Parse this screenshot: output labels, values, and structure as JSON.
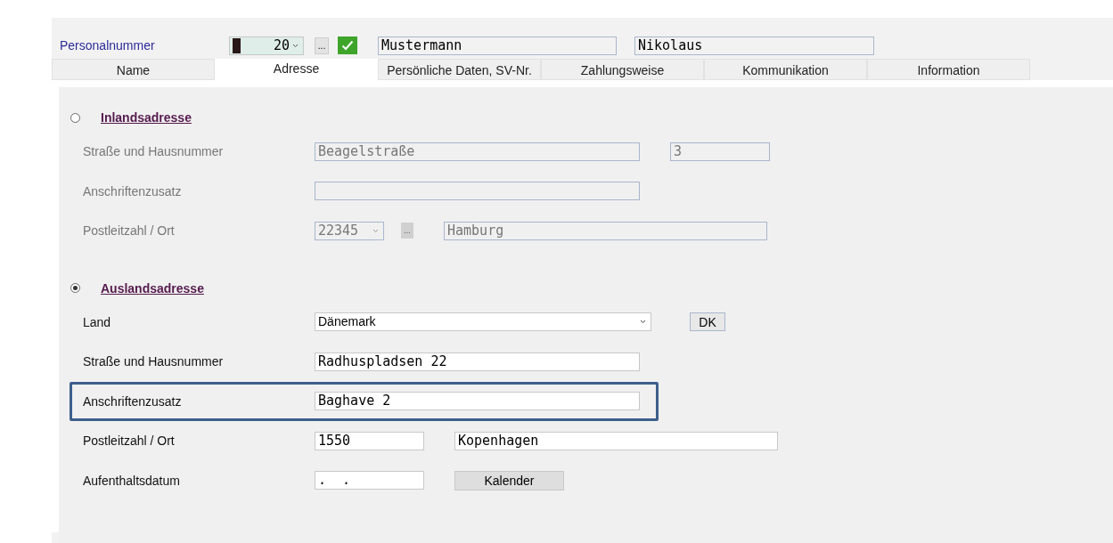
{
  "header": {
    "label": "Personalnummer",
    "number": "20",
    "dots": "...",
    "checked": true,
    "last_name": "Mustermann",
    "first_name": "Nikolaus"
  },
  "tabs": [
    {
      "label": "Name",
      "selected": false
    },
    {
      "label": "Adresse",
      "selected": true
    },
    {
      "label": "Persönliche Daten, SV-Nr.",
      "selected": false
    },
    {
      "label": "Zahlungsweise",
      "selected": false
    },
    {
      "label": "Kommunikation",
      "selected": false
    },
    {
      "label": "Information",
      "selected": false
    }
  ],
  "sections": [
    {
      "title": "Inlandsadresse",
      "selected": false,
      "rows": [
        {
          "label": "Straße und Hausnummer",
          "highlighted": false,
          "fields": [
            {
              "kind": "wide",
              "value": "Beagelstraße"
            },
            {
              "kind": "short",
              "value": "3"
            }
          ]
        },
        {
          "label": "Anschriftenzusatz",
          "highlighted": false,
          "fields": [
            {
              "kind": "wide"
            }
          ]
        },
        {
          "label": "Postleitzahl / Ort",
          "highlighted": false,
          "fields": [
            {
              "kind": "combo",
              "value": "22345"
            },
            {
              "kind": "dots",
              "value": "..."
            },
            {
              "kind": "city",
              "value": "Hamburg"
            }
          ]
        }
      ]
    },
    {
      "title": "Auslandsadresse",
      "selected": true,
      "rows": [
        {
          "label": "Land",
          "highlighted": false,
          "fields": [
            {
              "kind": "dropdown",
              "value": "Dänemark"
            },
            {
              "kind": "code",
              "value": "DK"
            }
          ]
        },
        {
          "label": "Straße und Hausnummer",
          "highlighted": false,
          "fields": [
            {
              "kind": "wide",
              "value": "Radhuspladsen 22"
            }
          ]
        },
        {
          "label": "Anschriftenzusatz",
          "highlighted": true,
          "fields": [
            {
              "kind": "wide",
              "value": "Baghave 2"
            }
          ]
        },
        {
          "label": "Postleitzahl / Ort",
          "highlighted": false,
          "fields": [
            {
              "kind": "postal",
              "value": "1550"
            },
            {
              "kind": "city",
              "value": "Kopenhagen"
            }
          ]
        },
        {
          "label": "Aufenthaltsdatum",
          "highlighted": false,
          "fields": [
            {
              "kind": "postal",
              "value": ".  ."
            },
            {
              "kind": "button",
              "value": "Kalender"
            }
          ]
        }
      ]
    }
  ]
}
